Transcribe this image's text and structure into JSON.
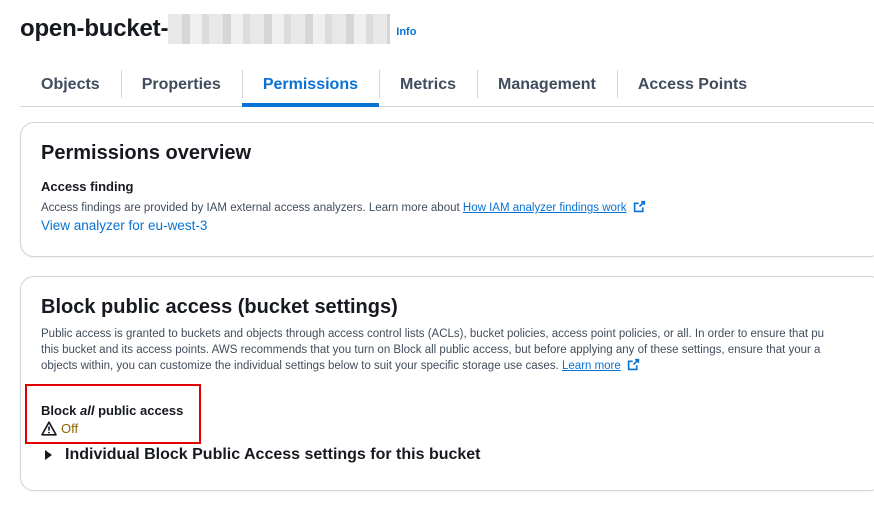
{
  "header": {
    "bucket_name": "open-bucket-",
    "info_label": "Info"
  },
  "tabs": [
    {
      "label": "Objects",
      "active": false
    },
    {
      "label": "Properties",
      "active": false
    },
    {
      "label": "Permissions",
      "active": true
    },
    {
      "label": "Metrics",
      "active": false
    },
    {
      "label": "Management",
      "active": false
    },
    {
      "label": "Access Points",
      "active": false
    }
  ],
  "permissions_overview": {
    "title": "Permissions overview",
    "access_finding_label": "Access finding",
    "description": "Access findings are provided by IAM external access analyzers. Learn more about",
    "how_link": "How IAM analyzer findings work",
    "view_analyzer_link": "View analyzer for eu-west-3"
  },
  "block_public_access": {
    "title": "Block public access (bucket settings)",
    "description_line1": "Public access is granted to buckets and objects through access control lists (ACLs), bucket policies, access point policies, or all. In order to ensure that pu",
    "description_line2": "this bucket and its access points. AWS recommends that you turn on Block all public access, but before applying any of these settings, ensure that your a",
    "description_line3": "objects within, you can customize the individual settings below to suit your specific storage use cases.",
    "learn_more_link": "Learn more",
    "setting_label_prefix": "Block ",
    "setting_label_emphasis": "all",
    "setting_label_suffix": " public access",
    "status": "Off",
    "expander_label": "Individual Block Public Access settings for this bucket"
  },
  "colors": {
    "accent": "#0972d3",
    "warning": "#8d6605",
    "highlight": "#e30000"
  },
  "icons": [
    "external-link-icon",
    "warning-icon",
    "caret-right-icon"
  ]
}
